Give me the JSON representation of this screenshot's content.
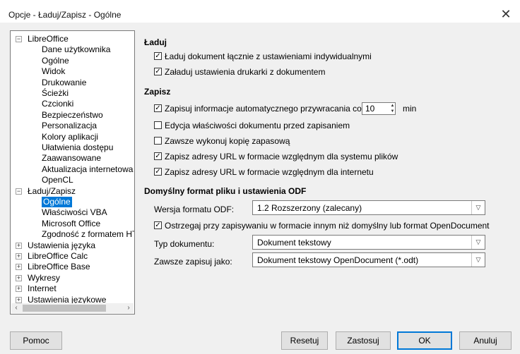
{
  "window": {
    "title": "Opcje - Ładuj/Zapisz - Ogólne",
    "close_icon": "close-icon"
  },
  "tree": {
    "root1": "LibreOffice",
    "root1_children": [
      "Dane użytkownika",
      "Ogólne",
      "Widok",
      "Drukowanie",
      "Ścieżki",
      "Czcionki",
      "Bezpieczeństwo",
      "Personalizacja",
      "Kolory aplikacji",
      "Ułatwienia dostępu",
      "Zaawansowane",
      "Aktualizacja internetowa",
      "OpenCL"
    ],
    "root2": "Ładuj/Zapisz",
    "root2_children": [
      "Ogólne",
      "Właściwości VBA",
      "Microsoft Office",
      "Zgodność z formatem HTI"
    ],
    "roots": [
      "Ustawienia języka",
      "LibreOffice Calc",
      "LibreOffice Base",
      "Wykresy",
      "Internet",
      "Ustawienia językowe"
    ],
    "selected": "Ogólne",
    "expand_minus": "−",
    "expand_plus": "+",
    "scroll_left": "‹",
    "scroll_right": "›"
  },
  "load": {
    "heading": "Ładuj",
    "opt1": "Ładuj dokument łącznie z ustawieniami indywidualnymi",
    "opt2": "Załaduj ustawienia drukarki z dokumentem"
  },
  "save": {
    "heading": "Zapisz",
    "autorecovery_label": "Zapisuj informacje automatycznego przywracania co:",
    "autorecovery_value": "10",
    "autorecovery_unit": "min",
    "opt_edit_props": "Edycja właściwości dokumentu przed zapisaniem",
    "opt_backup": "Zawsze wykonuj kopię zapasową",
    "opt_url_fs": "Zapisz adresy URL w formacie względnym dla systemu plików",
    "opt_url_inet": "Zapisz adresy URL w formacie względnym dla internetu"
  },
  "format": {
    "heading": "Domyślny format pliku i ustawienia ODF",
    "odf_label": "Wersja formatu ODF:",
    "odf_value": "1.2 Rozszerzony (zalecany)",
    "warn_label": "Ostrzegaj przy zapisywaniu w formacie innym niż domyślny lub format OpenDocument",
    "doctype_label": "Typ dokumentu:",
    "doctype_value": "Dokument tekstowy",
    "saveas_label": "Zawsze zapisuj jako:",
    "saveas_value": "Dokument tekstowy OpenDocument (*.odt)"
  },
  "checkmark": "✓",
  "states": {
    "opt1": true,
    "opt2": true,
    "autorecovery": true,
    "edit_props": false,
    "backup": false,
    "url_fs": true,
    "url_inet": true,
    "warn": true
  },
  "buttons": {
    "help": "Pomoc",
    "reset": "Resetuj",
    "apply": "Zastosuj",
    "ok": "OK",
    "cancel": "Anuluj"
  },
  "colors": {
    "selection": "#0078d7",
    "dialog_bg": "#f0f0f0"
  }
}
